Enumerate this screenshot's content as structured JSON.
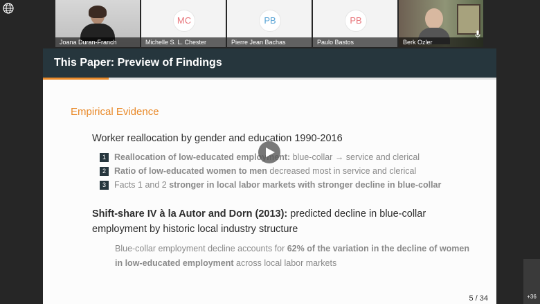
{
  "participants": [
    {
      "name": "Joana Duran-Franch",
      "initials": ""
    },
    {
      "name": "Michelle S. L. Chester",
      "initials": "MC",
      "color": "#e8747a"
    },
    {
      "name": "Pierre Jean Bachas",
      "initials": "PB",
      "color": "#5aa4d6"
    },
    {
      "name": "Paulo Bastos",
      "initials": "PB",
      "color": "#e8747a"
    },
    {
      "name": "Berk Ozler",
      "initials": ""
    }
  ],
  "more_participants": "+36",
  "slide": {
    "title": "This Paper: Preview of Findings",
    "section": "Empirical Evidence",
    "lead": "Worker reallocation by gender and education 1990-2016",
    "items": [
      {
        "num": "1",
        "bold": "Reallocation of low-educated employment:",
        "rest": " blue-collar → service and clerical"
      },
      {
        "num": "2",
        "bold": "Ratio of low-educated women to men",
        "rest": " decreased most in service and clerical"
      },
      {
        "num": "3",
        "pre": "Facts 1 and 2 ",
        "bold": "stronger in local labor markets with stronger decline in blue-collar"
      }
    ],
    "shift_bold": "Shift-share IV à la Autor and Dorn (2013):",
    "shift_rest": " predicted decline in blue-collar employment by historic local industry structure",
    "note_pre": "Blue-collar employment decline accounts for ",
    "note_bold1": "62% of the variation in the decline of women in low-educated employment",
    "note_rest": " across local labor markets",
    "page": "5 / 34"
  }
}
